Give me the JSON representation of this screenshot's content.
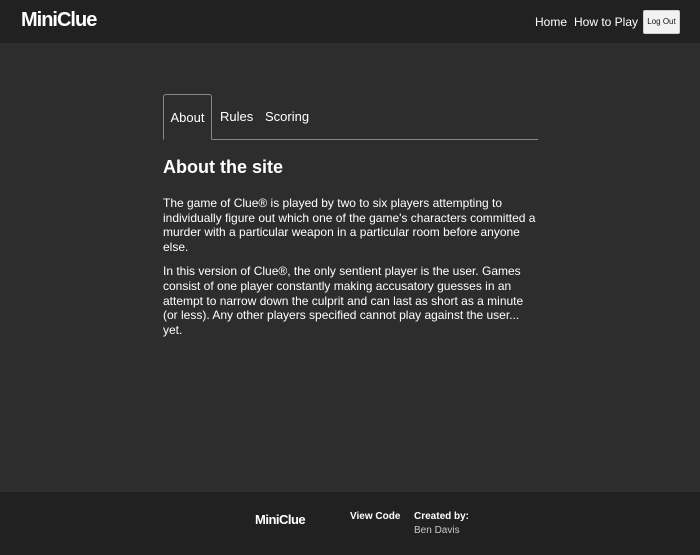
{
  "navbar": {
    "brand": "MiniClue",
    "links": {
      "home": "Home",
      "how_to_play": "How to Play"
    },
    "logout_label": "Log Out"
  },
  "tabs": [
    {
      "label": "About",
      "active": true
    },
    {
      "label": "Rules",
      "active": false
    },
    {
      "label": "Scoring",
      "active": false
    }
  ],
  "main": {
    "title": "About the site",
    "paragraphs": [
      "The game of Clue® is played by two to six players attempting to individually figure out which one of the game's characters committed a murder with a particular weapon in a particular room before anyone else.",
      "In this version of Clue®, the only sentient player is the user. Games consist of one player constantly making accusatory guesses in an attempt to narrow down the culprit and can last as short as a minute (or less). Any other players specified cannot play against the user... yet."
    ]
  },
  "footer": {
    "brand": "MiniClue",
    "view_code": "View Code",
    "created_by_label": "Created by:",
    "author": "Ben Davis"
  },
  "colors": {
    "page_bg": "#2d2d2d",
    "bar_bg": "#212121",
    "text": "#ffffff",
    "muted_text": "#c9c9c9",
    "tab_border": "#8a8a8a",
    "button_bg": "#f2f2f2"
  }
}
